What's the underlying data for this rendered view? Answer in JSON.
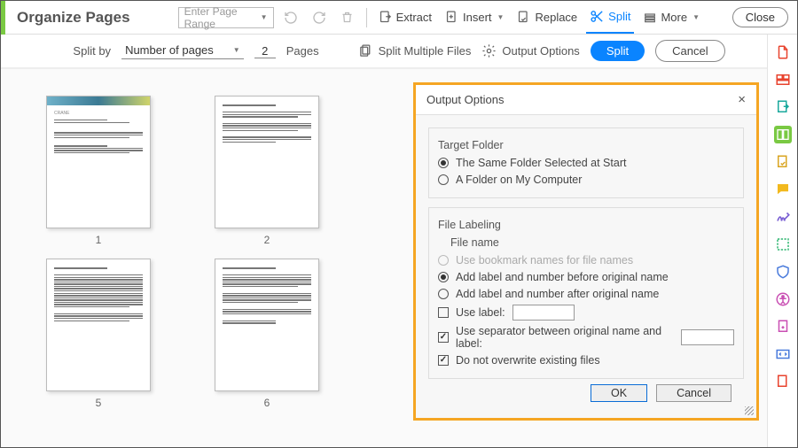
{
  "toolbar": {
    "title": "Organize Pages",
    "page_range_placeholder": "Enter Page Range",
    "extract": "Extract",
    "insert": "Insert",
    "replace": "Replace",
    "split": "Split",
    "more": "More",
    "close": "Close"
  },
  "subbar": {
    "split_by": "Split by",
    "mode": "Number of pages",
    "count": "2",
    "pages_lbl": "Pages",
    "multi": "Split Multiple Files",
    "output_opts": "Output Options",
    "split_btn": "Split",
    "cancel_btn": "Cancel"
  },
  "thumbs": {
    "p1": "1",
    "p2": "2",
    "p5": "5",
    "p6": "6"
  },
  "dialog": {
    "title": "Output Options",
    "target_folder": "Target Folder",
    "opt_same": "The Same Folder Selected at Start",
    "opt_diff": "A Folder on My Computer",
    "file_labeling": "File Labeling",
    "file_name": "File name",
    "fn_bookmark": "Use bookmark names for file names",
    "fn_before": "Add label and number before original name",
    "fn_after": "Add label and number after original name",
    "use_label": "Use label:",
    "use_sep": "Use separator between original name and label:",
    "no_overwrite": "Do not overwrite existing files",
    "ok": "OK",
    "cancel": "Cancel"
  }
}
